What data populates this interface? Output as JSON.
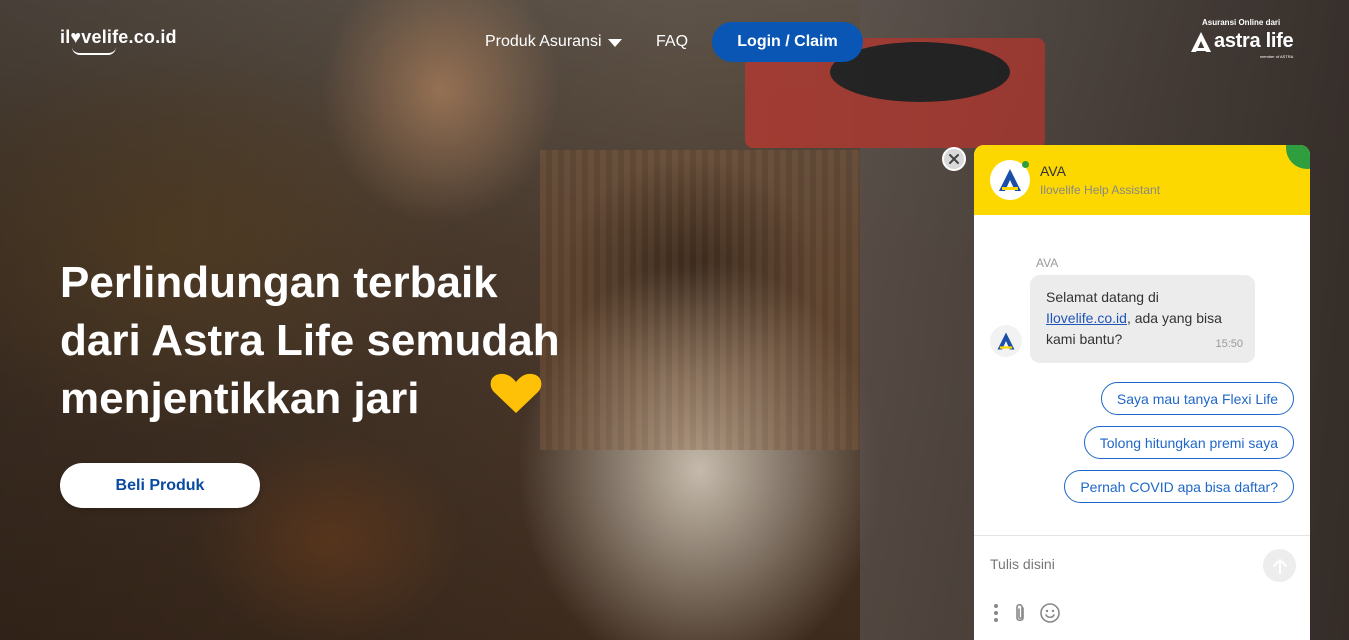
{
  "header": {
    "logo_text": "il♥velife.co.id",
    "nav_products": "Produk Asuransi",
    "nav_faq": "FAQ",
    "login_button": "Login / Claim",
    "brand_tagline": "Asuransi Online dari",
    "brand_name": "astra life",
    "brand_member": "member of ASTRA"
  },
  "hero": {
    "headline_lines": [
      "Perlindungan terbaik",
      "dari Astra Life semudah",
      "menjentikkan jari"
    ],
    "cta_button": "Beli Produk",
    "heart_color": "#FFC107"
  },
  "chat": {
    "agent_name": "AVA",
    "agent_subtitle": "Ilovelife Help Assistant",
    "sender_label": "AVA",
    "message_pre": "Selamat datang di ",
    "message_link": "Ilovelife.co.id",
    "message_post": ", ada yang bisa kami bantu?",
    "message_time": "15:50",
    "quick_replies": [
      "Saya mau tanya Flexi Life",
      "Tolong hitungkan premi saya",
      "Pernah COVID apa bisa daftar?"
    ],
    "input_placeholder": "Tulis disini",
    "header_color": "#FCD800",
    "accent_color": "#1F67C8"
  }
}
